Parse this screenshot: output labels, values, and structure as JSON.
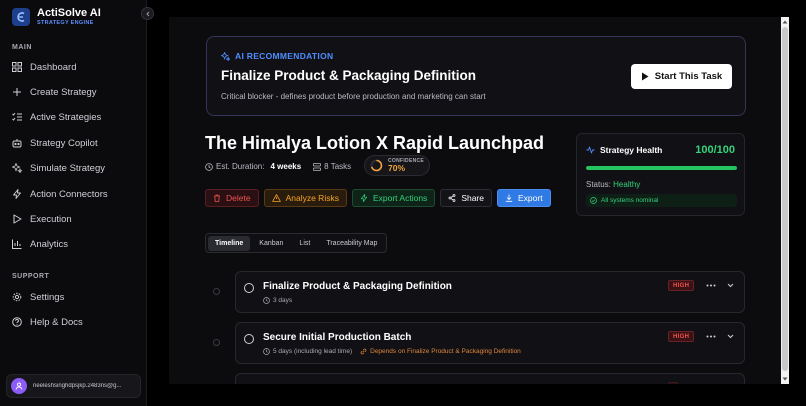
{
  "brand": {
    "name": "ActiSolve AI",
    "tagline": "STRATEGY ENGINE"
  },
  "sidebar": {
    "main_label": "MAIN",
    "main_items": [
      {
        "label": "Dashboard",
        "icon": "grid-icon"
      },
      {
        "label": "Create Strategy",
        "icon": "plus-icon"
      },
      {
        "label": "Active Strategies",
        "icon": "list-check-icon"
      },
      {
        "label": "Strategy Copilot",
        "icon": "copilot-icon"
      },
      {
        "label": "Simulate Strategy",
        "icon": "sparkles-icon"
      },
      {
        "label": "Action Connectors",
        "icon": "bolt-icon"
      },
      {
        "label": "Execution",
        "icon": "play-icon"
      },
      {
        "label": "Analytics",
        "icon": "bar-chart-icon"
      }
    ],
    "support_label": "SUPPORT",
    "support_items": [
      {
        "label": "Settings",
        "icon": "gear-icon"
      },
      {
        "label": "Help & Docs",
        "icon": "help-icon"
      }
    ],
    "user_email": "neeleshsinghdpsjkp.2483ns@g..."
  },
  "recommendation": {
    "tag": "AI RECOMMENDATION",
    "title": "Finalize Product & Packaging Definition",
    "subtitle": "Critical blocker - defines product before production and marketing can start",
    "cta": "Start This Task"
  },
  "project": {
    "title": "The Himalya Lotion X Rapid Launchpad",
    "duration_label": "Est. Duration:",
    "duration_value": "4 weeks",
    "tasks_count": "8 Tasks",
    "confidence_label": "CONFIDENCE",
    "confidence_value": "70%",
    "confidence_fraction": 0.7
  },
  "actions": {
    "delete": "Delete",
    "analyze": "Analyze Risks",
    "export_actions": "Export Actions",
    "share": "Share",
    "export": "Export"
  },
  "health": {
    "title": "Strategy Health",
    "score": "100/100",
    "fraction": 1.0,
    "status_label": "Status:",
    "status_value": "Healthy",
    "note": "All systems nominal"
  },
  "tabs": [
    "Timeline",
    "Kanban",
    "List",
    "Traceability Map"
  ],
  "active_tab": "Timeline",
  "tasks": [
    {
      "title": "Finalize Product & Packaging Definition",
      "duration": "3 days",
      "dependency": "",
      "priority": "HIGH"
    },
    {
      "title": "Secure Initial Production Batch",
      "duration": "5 days (including lead time)",
      "dependency": "Depends on Finalize Product & Packaging Definition",
      "priority": "HIGH"
    }
  ],
  "colors": {
    "accent": "#2f7ae5",
    "success": "#34d27b",
    "danger": "#f05252",
    "warning": "#f5a524"
  }
}
